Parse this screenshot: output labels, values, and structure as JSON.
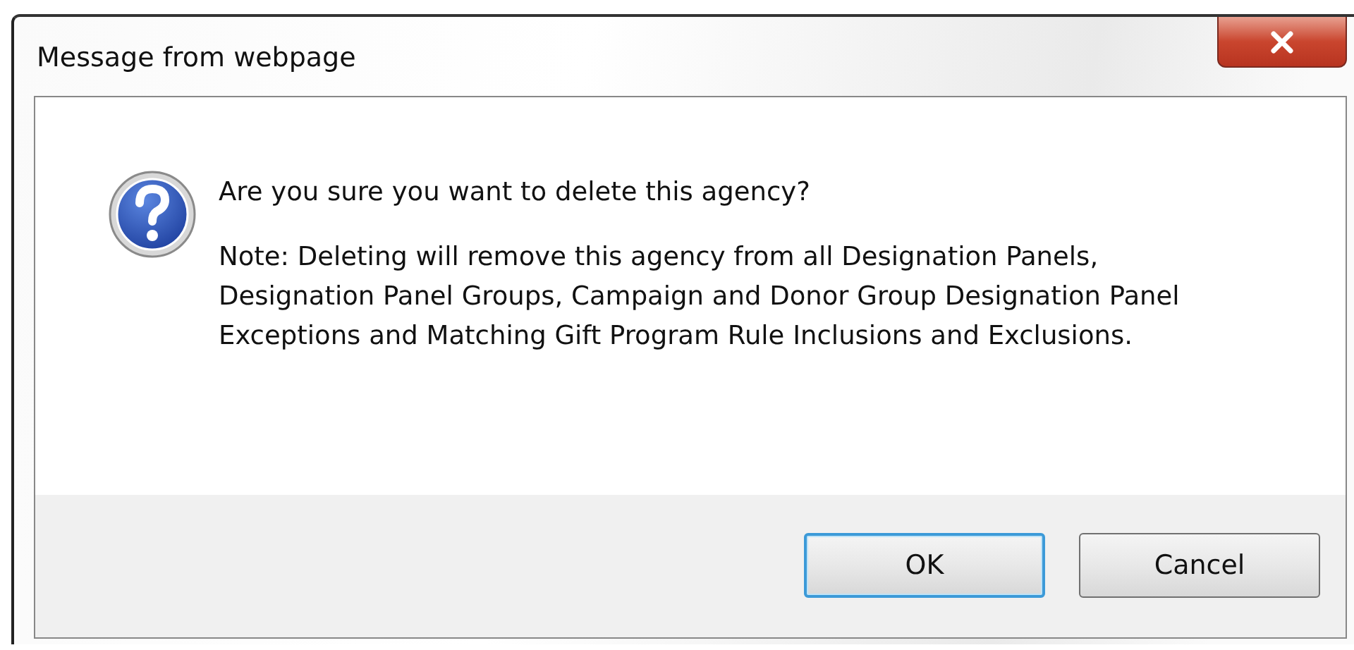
{
  "window": {
    "title": "Message from webpage"
  },
  "message": {
    "question": "Are you sure you want to delete this agency?",
    "note": "Note: Deleting will remove this agency from all Designation Panels, Designation Panel Groups, Campaign and Donor Group Designation Panel Exceptions and Matching Gift Program Rule Inclusions and Exclusions."
  },
  "buttons": [
    {
      "label": "OK",
      "focused": true
    },
    {
      "label": "Cancel",
      "focused": false
    }
  ]
}
